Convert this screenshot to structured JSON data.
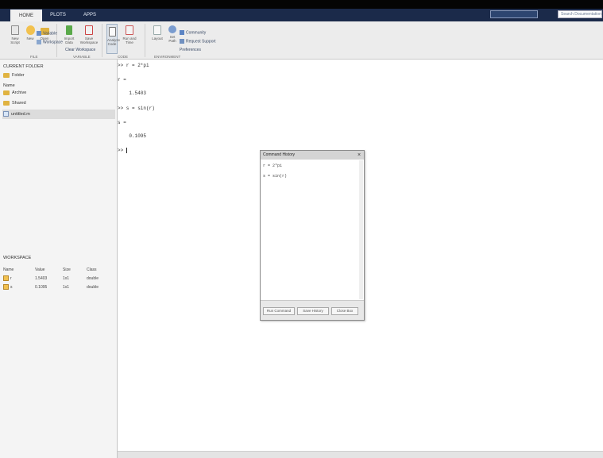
{
  "tabs": [
    "HOME",
    "PLOTS",
    "APPS"
  ],
  "search_documentation": "Search Documentation",
  "search_field_left": "",
  "toolstrip": {
    "groups": [
      "FILE",
      "VARIABLE",
      "CODE",
      "ENVIRONMENT"
    ],
    "tools": [
      {
        "label": "New Script",
        "icon": "new-script-icon"
      },
      {
        "label": "New",
        "icon": "new-icon"
      },
      {
        "label": "Open",
        "icon": "open-icon"
      },
      {
        "label": "Import Data",
        "icon": "import-data-icon"
      },
      {
        "label": "Save Workspace",
        "icon": "save-workspace-icon"
      },
      {
        "label": "Analyze Code",
        "icon": "analyze-code-icon"
      },
      {
        "label": "Run and Time",
        "icon": "run-time-icon"
      },
      {
        "label": "Layout",
        "icon": "layout-icon"
      },
      {
        "label": "Set Path",
        "icon": "set-path-icon"
      }
    ],
    "mini_items": [
      "Variable",
      "Workspace",
      "Clear Workspace",
      "Community",
      "Request Support",
      "Preferences"
    ]
  },
  "left_panel": {
    "current_folder_title": "CURRENT FOLDER",
    "name_header": "Name",
    "items": [
      {
        "label": "Folder",
        "type": "folder"
      },
      {
        "label": "Archive",
        "type": "folder"
      },
      {
        "label": "Shared",
        "type": "folder"
      },
      {
        "label": "untitled.m",
        "type": "file"
      }
    ],
    "workspace_title": "WORKSPACE",
    "workspace_headers": [
      "Name",
      "Value",
      "Size",
      "Class"
    ],
    "workspace_rows": [
      {
        "name": "r",
        "value": "1.5403",
        "size": "1x1",
        "class": "double"
      },
      {
        "name": "s",
        "value": "0.1095",
        "size": "1x1",
        "class": "double"
      }
    ]
  },
  "command_window": {
    "lines": [
      ">> r = 2*pi",
      "r =",
      "    1.5403",
      ">> s = sin(r)",
      "s =",
      "    0.1095",
      ">> "
    ]
  },
  "dialog": {
    "title": "Command History",
    "lines": [
      "r = 2*pi",
      "s = sin(r)"
    ],
    "buttons": [
      "Run Command",
      "Save History",
      "Close Box"
    ]
  },
  "colors": {
    "topbar": "#1b2a4a",
    "toolstrip": "#ececec",
    "panel": "#f4f4f4",
    "command_bg": "#ffffff"
  }
}
